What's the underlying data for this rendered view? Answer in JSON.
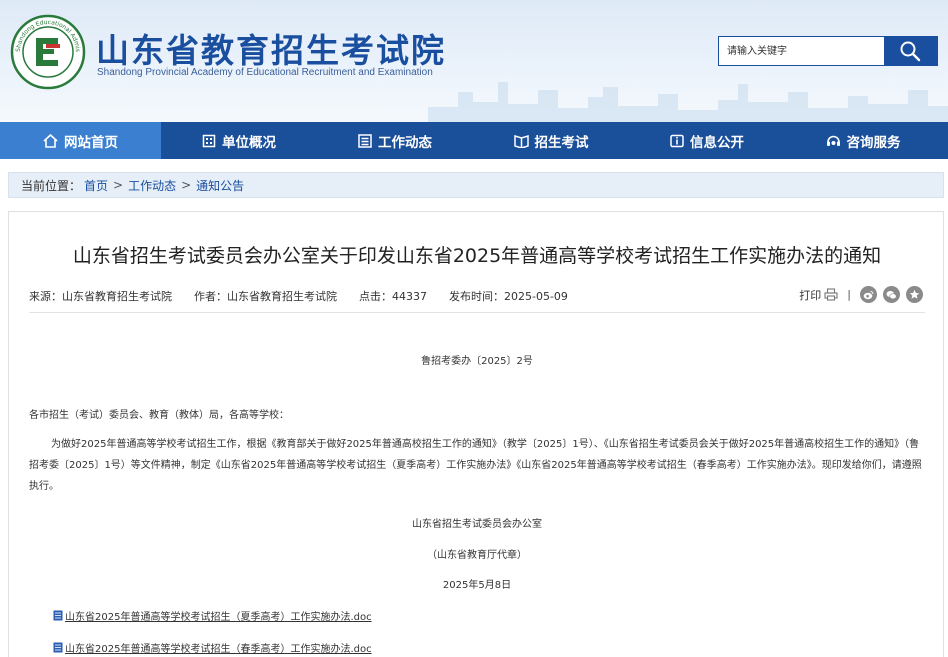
{
  "header": {
    "title": "山东省教育招生考试院",
    "subtitle": "Shandong Provincial Academy of Educational Recruitment and Examination",
    "logo_text": "Shandong Educational Admission & Examination"
  },
  "search": {
    "placeholder": "请输入关键字"
  },
  "nav": {
    "items": [
      {
        "label": "网站首页",
        "icon": "home-icon"
      },
      {
        "label": "单位概况",
        "icon": "building-icon"
      },
      {
        "label": "工作动态",
        "icon": "list-icon"
      },
      {
        "label": "招生考试",
        "icon": "book-icon"
      },
      {
        "label": "信息公开",
        "icon": "info-icon"
      },
      {
        "label": "咨询服务",
        "icon": "service-icon"
      }
    ]
  },
  "breadcrumb": {
    "label": "当前位置：",
    "items": [
      "首页",
      "工作动态",
      "通知公告"
    ],
    "separator": ">"
  },
  "article": {
    "title": "山东省招生考试委员会办公室关于印发山东省2025年普通高等学校考试招生工作实施办法的通知",
    "meta": {
      "source": "来源：山东省教育招生考试院",
      "author": "作者：山东省教育招生考试院",
      "clicks": "点击：44337",
      "date": "发布时间：2025-05-09"
    },
    "print_label": "打印",
    "doc_number": "鲁招考委办〔2025〕2号",
    "salutation": "各市招生（考试）委员会、教育（教体）局，各高等学校：",
    "paragraph": "为做好2025年普通高等学校考试招生工作，根据《教育部关于做好2025年普通高校招生工作的通知》（教学〔2025〕1号）、《山东省招生考试委员会关于做好2025年普通高校招生工作的通知》（鲁招考委〔2025〕1号）等文件精神，制定《山东省2025年普通高等学校考试招生（夏季高考）工作实施办法》《山东省2025年普通高等学校考试招生（春季高考）工作实施办法》。现印发给你们，请遵照执行。",
    "signature": "山东省招生考试委员会办公室",
    "signature_note": "（山东省教育厅代章）",
    "sign_date": "2025年5月8日",
    "attachments": [
      "山东省2025年普通高等学校考试招生（夏季高考）工作实施办法.doc",
      "山东省2025年普通高等学校考试招生（春季高考）工作实施办法.doc"
    ]
  },
  "colors": {
    "brand": "#1a4fa0",
    "nav_bg": "#1a4f9a",
    "nav_active": "#3a7fd0"
  }
}
